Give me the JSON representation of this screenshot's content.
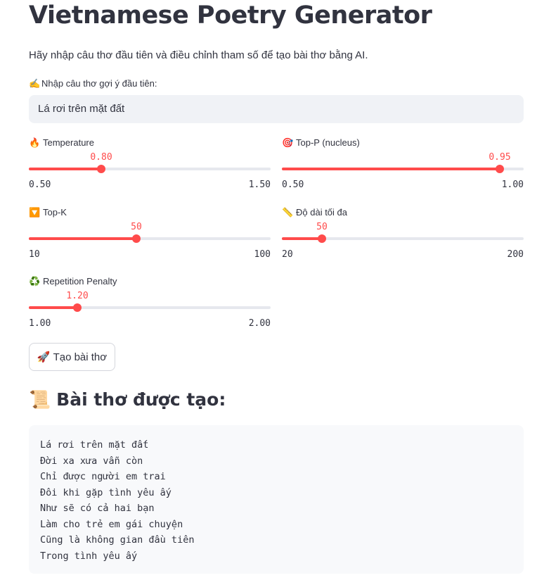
{
  "title": "Vietnamese Poetry Generator",
  "intro": "Hãy nhập câu thơ đầu tiên và điều chỉnh tham số để tạo bài thơ bằng AI.",
  "prompt_input": {
    "icon": "✍️",
    "label": "Nhập câu thơ gợi ý đầu tiên:",
    "value": "Lá rơi trên mặt đất"
  },
  "sliders": {
    "temperature": {
      "icon": "🔥",
      "label": "Temperature",
      "value": "0.80",
      "min": "0.50",
      "max": "1.50",
      "fraction": 0.3
    },
    "top_p": {
      "icon": "🎯",
      "label": "Top-P (nucleus)",
      "value": "0.95",
      "min": "0.50",
      "max": "1.00",
      "fraction": 0.9
    },
    "top_k": {
      "icon": "🔽",
      "label": "Top-K",
      "value": "50",
      "min": "10",
      "max": "100",
      "fraction": 0.4444
    },
    "max_length": {
      "icon": "📏",
      "label": "Độ dài tối đa",
      "value": "50",
      "min": "20",
      "max": "200",
      "fraction": 0.1667
    },
    "repetition_penalty": {
      "icon": "♻️",
      "label": "Repetition Penalty",
      "value": "1.20",
      "min": "1.00",
      "max": "2.00",
      "fraction": 0.2
    }
  },
  "generate_button": {
    "icon": "🚀",
    "label": "Tạo bài thơ"
  },
  "result": {
    "icon": "📜",
    "heading": "Bài thơ được tạo:",
    "lines": [
      "Lá rơi trên mặt đất",
      "Đời xa xưa vẫn còn",
      "Chỉ được người em trai",
      "Đôi khi gặp tình yêu ấy",
      "Như sẽ có cả hai bạn",
      "Làm cho trẻ em gái chuyện",
      "Cũng là không gian đầu tiên",
      "Trong tình yêu ấy"
    ]
  },
  "colors": {
    "accent": "#ff4b4b",
    "text": "#31333f",
    "input_bg": "#f0f2f6",
    "code_bg": "#f8f9fb",
    "track": "#e6e8ee"
  }
}
